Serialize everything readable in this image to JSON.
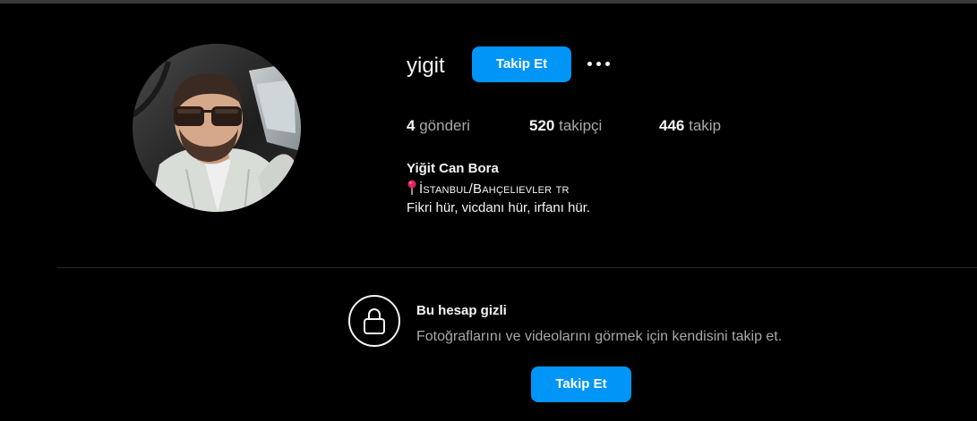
{
  "profile": {
    "username": "yigit",
    "full_name": "Yiğit Can Bora",
    "location": "İstanbul/Bahçelievler tr",
    "tagline": "Fikri hür, vicdanı hür, irfanı hür.",
    "follow_label": "Takip Et"
  },
  "stats": {
    "posts_count": "4",
    "posts_label": "gönderi",
    "followers_count": "520",
    "followers_label": "takipçi",
    "following_count": "446",
    "following_label": "takip"
  },
  "private_notice": {
    "title": "Bu hesap gizli",
    "description": "Fotoğraflarını ve videolarını görmek için kendisini takip et.",
    "follow_label": "Takip Et"
  },
  "icons": {
    "more": "more-options-icon",
    "lock": "lock-icon",
    "pin": "round-pushpin-icon"
  },
  "colors": {
    "background": "#000000",
    "accent": "#0095f6",
    "text_primary": "#f5f5f5",
    "text_secondary": "#a8a8a8"
  }
}
